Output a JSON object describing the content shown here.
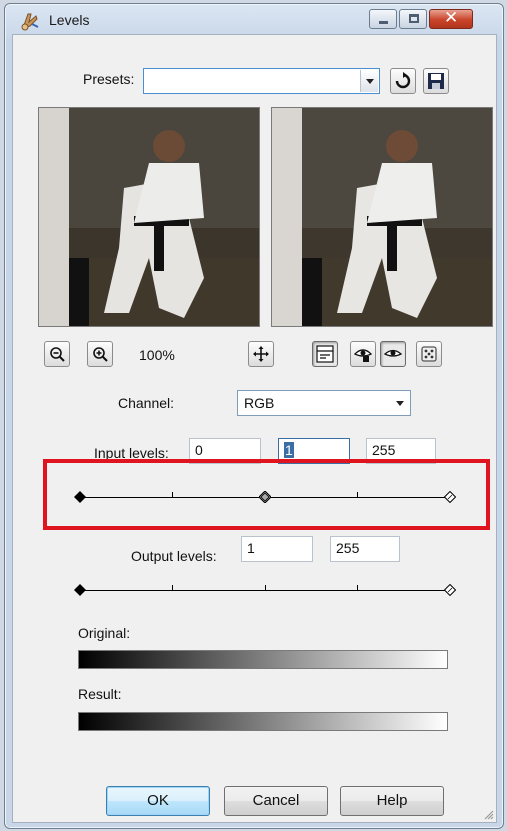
{
  "window": {
    "title": "Levels",
    "title_icon": "levels-app-icon",
    "controls": [
      "minimize-icon",
      "maximize-icon",
      "close-icon"
    ]
  },
  "presets": {
    "label": "Presets:",
    "value": "",
    "icons": [
      "reset-arrow-icon",
      "save-disk-icon"
    ]
  },
  "preview": {
    "zoom_label": "100%",
    "left_toolbar": [
      "zoom-out-icon",
      "zoom-in-icon"
    ],
    "center_icon": "navigate-crosshair-icon",
    "right_toolbar": [
      "proof-toggle-icon",
      "auto-proof-icon",
      "eye-icon",
      "randomize-dice-icon"
    ]
  },
  "channel": {
    "label": "Channel:",
    "value": "RGB"
  },
  "input_levels": {
    "label": "Input levels:",
    "black": "0",
    "gamma": "1",
    "white": "255",
    "gamma_position_fraction": 0.5
  },
  "output_levels": {
    "label": "Output levels:",
    "black": "1",
    "white": "255"
  },
  "ramps": {
    "original_label": "Original:",
    "result_label": "Result:"
  },
  "buttons": {
    "ok": "OK",
    "cancel": "Cancel",
    "help": "Help"
  },
  "colors": {
    "highlight_box": "#e0141e",
    "selection": "#3a6ea5",
    "default_button_border": "#3c7fb1"
  }
}
